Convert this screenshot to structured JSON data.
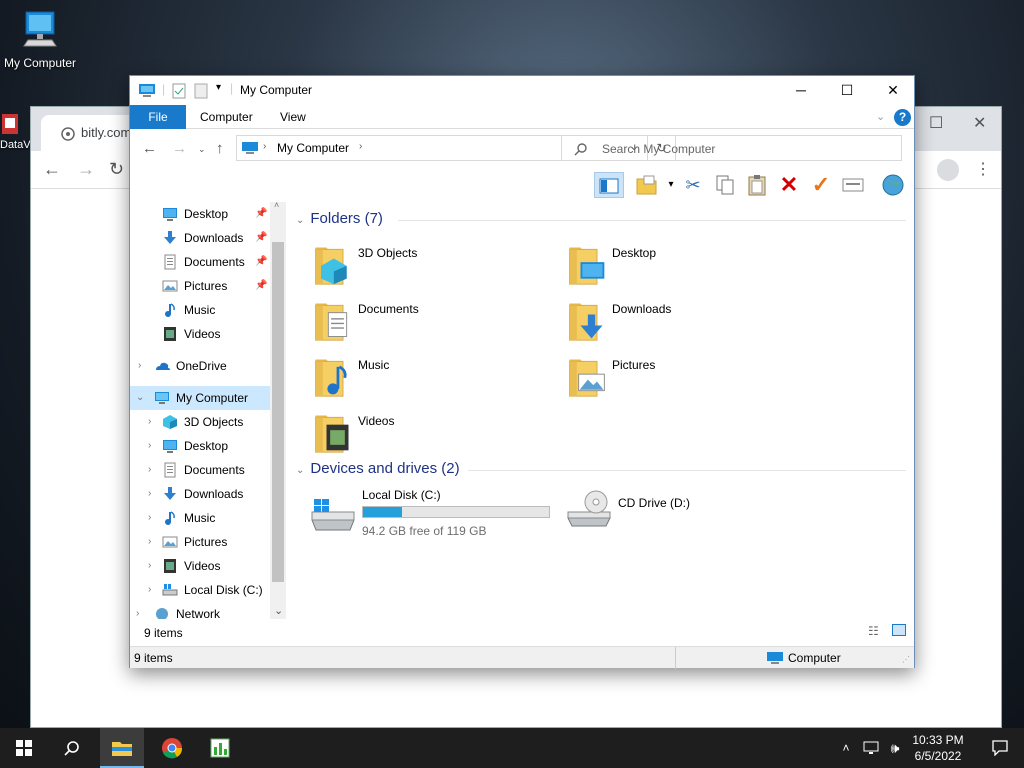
{
  "desktop": {
    "icon_label": "My Computer",
    "second_icon_label": "DataV"
  },
  "browser": {
    "tab_title": "bitly.com"
  },
  "explorer": {
    "title": "My Computer",
    "ribbon_tabs": [
      "File",
      "Computer",
      "View"
    ],
    "address": "My Computer",
    "search_placeholder": "Search My Computer",
    "nav": {
      "quick_access": [
        {
          "label": "Desktop",
          "icon": "desktop-icon",
          "pinned": true
        },
        {
          "label": "Downloads",
          "icon": "downloads-icon",
          "pinned": true
        },
        {
          "label": "Documents",
          "icon": "documents-icon",
          "pinned": true
        },
        {
          "label": "Pictures",
          "icon": "pictures-icon",
          "pinned": true
        },
        {
          "label": "Music",
          "icon": "music-icon",
          "pinned": false
        },
        {
          "label": "Videos",
          "icon": "videos-icon",
          "pinned": false
        }
      ],
      "onedrive": "OneDrive",
      "my_computer": "My Computer",
      "my_computer_children": [
        {
          "label": "3D Objects",
          "icon": "3d-objects-icon"
        },
        {
          "label": "Desktop",
          "icon": "desktop-icon"
        },
        {
          "label": "Documents",
          "icon": "documents-icon"
        },
        {
          "label": "Downloads",
          "icon": "downloads-icon"
        },
        {
          "label": "Music",
          "icon": "music-icon"
        },
        {
          "label": "Pictures",
          "icon": "pictures-icon"
        },
        {
          "label": "Videos",
          "icon": "videos-icon"
        },
        {
          "label": "Local Disk (C:)",
          "icon": "drive-icon"
        }
      ],
      "network": "Network"
    },
    "folders_header": "Folders (7)",
    "folders": [
      {
        "label": "3D Objects",
        "icon": "3d-objects-folder-icon"
      },
      {
        "label": "Desktop",
        "icon": "desktop-folder-icon"
      },
      {
        "label": "Documents",
        "icon": "documents-folder-icon"
      },
      {
        "label": "Downloads",
        "icon": "downloads-folder-icon"
      },
      {
        "label": "Music",
        "icon": "music-folder-icon"
      },
      {
        "label": "Pictures",
        "icon": "pictures-folder-icon"
      },
      {
        "label": "Videos",
        "icon": "videos-folder-icon"
      }
    ],
    "drives_header": "Devices and drives (2)",
    "drives": [
      {
        "label": "Local Disk (C:)",
        "free_text": "94.2 GB free of 119 GB",
        "used_fraction": 0.21
      },
      {
        "label": "CD Drive (D:)"
      }
    ],
    "status_items": "9 items",
    "statusbar_items": "9 items",
    "statusbar_location": "Computer",
    "colors": {
      "accent": "#1979ca",
      "group_header": "#1e3287",
      "usage_bar": "#26a0da"
    }
  },
  "taskbar": {
    "time": "10:33 PM",
    "date": "6/5/2022"
  }
}
